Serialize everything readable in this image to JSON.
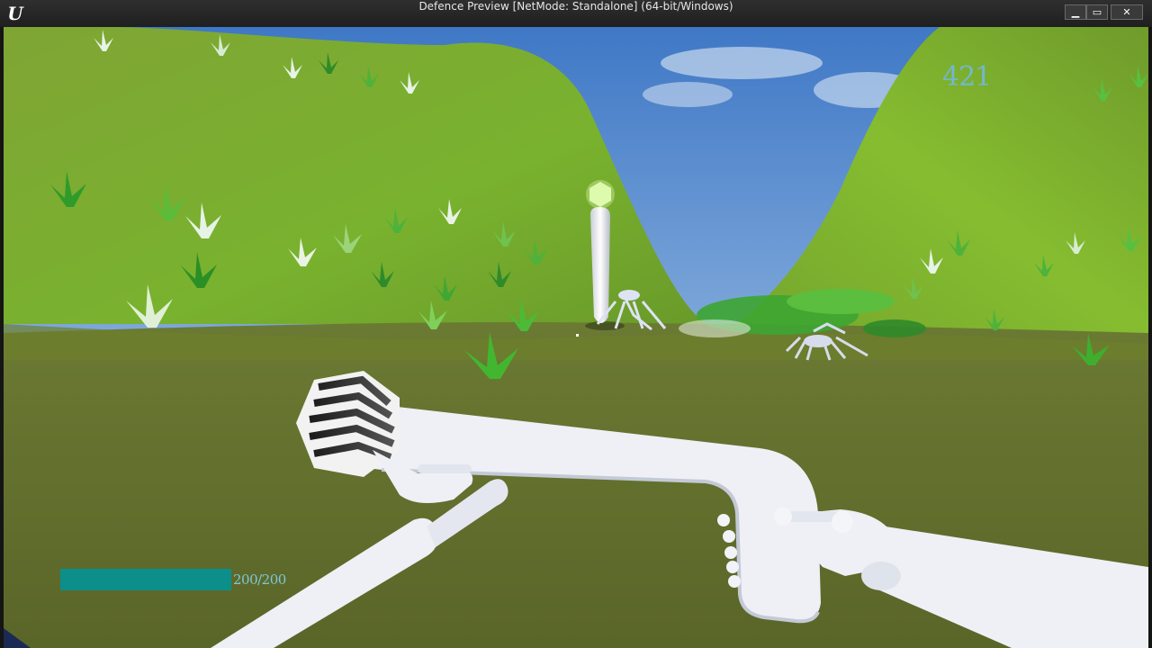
{
  "window": {
    "title": "Defence Preview [NetMode: Standalone]  (64-bit/Windows)",
    "logo_text": "U",
    "minimize_glyph": "▁",
    "maximize_glyph": "▭",
    "close_glyph": "✕"
  },
  "hud": {
    "score": "421",
    "health_text": "200/200",
    "health_fraction": 1.0,
    "health_color": "#0c8f8b"
  },
  "scene": {
    "sky_color": "#7aa5d6",
    "ground_color": "#5b6a2a",
    "hill_color": "#6e9e2a",
    "weapon_color": "#eef0f6"
  }
}
